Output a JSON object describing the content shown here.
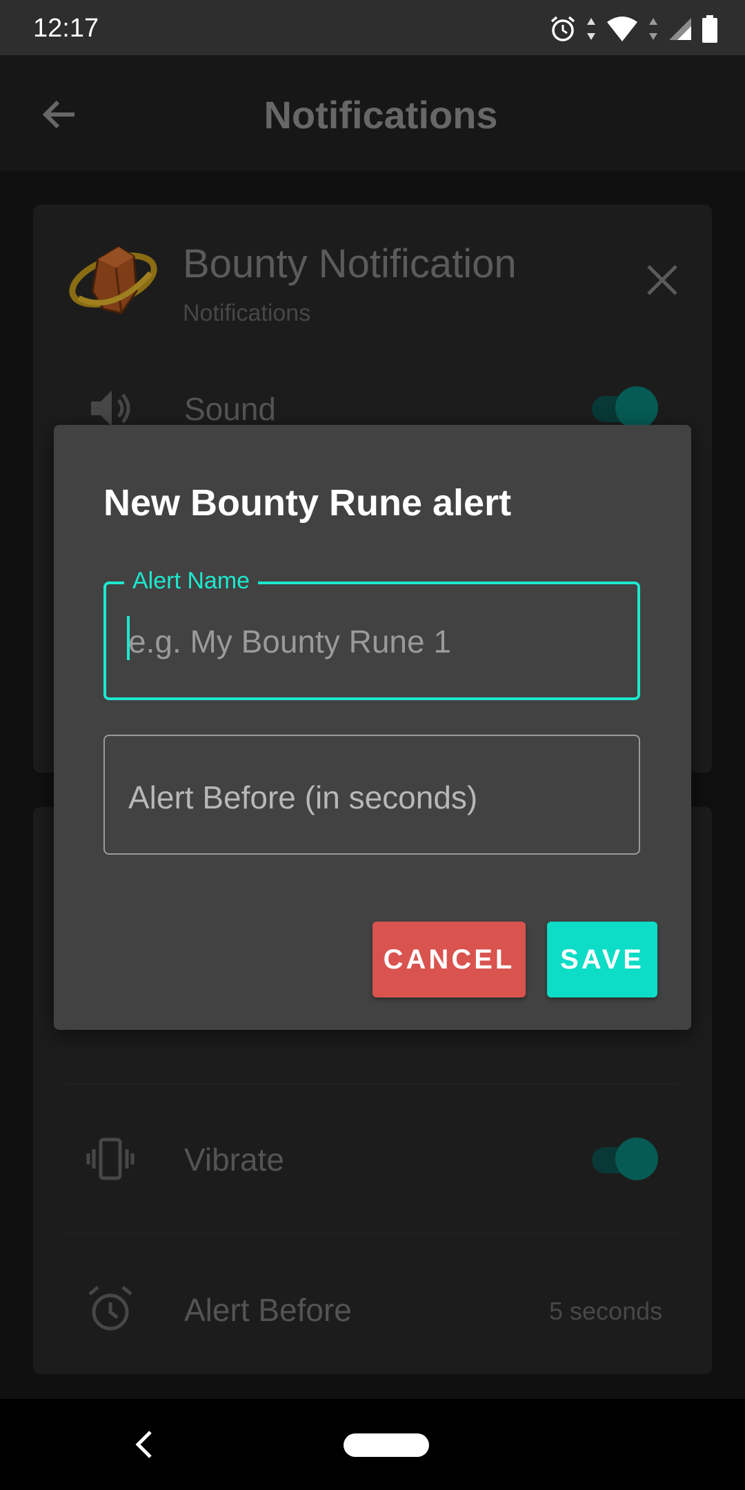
{
  "status_bar": {
    "time": "12:17"
  },
  "app_bar": {
    "title": "Notifications"
  },
  "notification_card": {
    "title": "Bounty Notification",
    "subtitle": "Notifications",
    "rows": {
      "sound": {
        "label": "Sound",
        "enabled": true
      },
      "vibrate": {
        "label": "Vibrate",
        "enabled": true
      },
      "alert_before": {
        "label": "Alert Before",
        "value": "5 seconds"
      }
    }
  },
  "dialog": {
    "title": "New Bounty Rune alert",
    "alert_name": {
      "label": "Alert Name",
      "placeholder": "e.g. My Bounty Rune 1",
      "value": ""
    },
    "alert_before": {
      "placeholder": "Alert Before (in seconds)",
      "value": ""
    },
    "cancel_label": "CANCEL",
    "save_label": "SAVE"
  },
  "colors": {
    "accent": "#1de9cf",
    "cancel": "#d9534f",
    "save": "#0ddcc6",
    "dialog_bg": "#424242",
    "toggle_on": "#087a70"
  }
}
